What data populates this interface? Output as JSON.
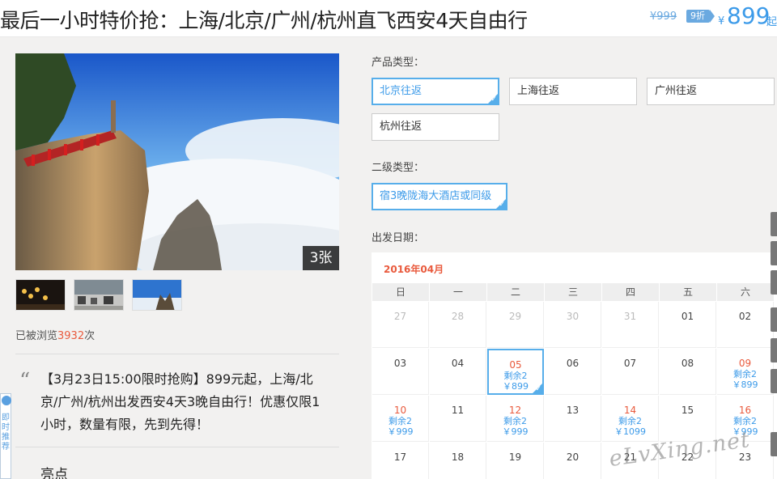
{
  "header": {
    "title": "最后一小时特价抢：上海/北京/广州/杭州直飞西安4天自由行",
    "original_price": "¥999",
    "discount": "9折",
    "yen": "¥",
    "price": "899",
    "price_suffix": "起"
  },
  "gallery": {
    "photo_count": "3张",
    "views_prefix": "已被浏览",
    "views_count": "3932",
    "views_suffix": "次"
  },
  "description": {
    "quote_mark": "“",
    "text": "【3月23日15:00限时抢购】899元起，上海/北京/广州/杭州出发西安4天3晚自由行！优惠仅限1小时，数量有限，先到先得！",
    "highlight_title": "亮点"
  },
  "side_tab": {
    "icon": "chat-icon",
    "text": "即时推荐"
  },
  "product_type": {
    "label": "产品类型：",
    "options": [
      {
        "label": "北京往返",
        "selected": true
      },
      {
        "label": "上海往返",
        "selected": false
      },
      {
        "label": "广州往返",
        "selected": false
      },
      {
        "label": "杭州往返",
        "selected": false
      }
    ]
  },
  "secondary_type": {
    "label": "二级类型：",
    "options": [
      {
        "label": "宿3晚陇海大酒店或同级",
        "selected": true
      }
    ]
  },
  "departure": {
    "label": "出发日期：",
    "month": "2016年04月",
    "weekdays": [
      "日",
      "一",
      "二",
      "三",
      "四",
      "五",
      "六"
    ],
    "weeks": [
      [
        {
          "day": "27",
          "status": "gray"
        },
        {
          "day": "28",
          "status": "gray"
        },
        {
          "day": "29",
          "status": "gray"
        },
        {
          "day": "30",
          "status": "gray"
        },
        {
          "day": "31",
          "status": "gray"
        },
        {
          "day": "01",
          "status": "normal"
        },
        {
          "day": "02",
          "status": "normal"
        }
      ],
      [
        {
          "day": "03",
          "status": "normal"
        },
        {
          "day": "04",
          "status": "normal"
        },
        {
          "day": "05",
          "status": "avail",
          "remain": "剩余2",
          "price": "￥899",
          "selected": true
        },
        {
          "day": "06",
          "status": "normal"
        },
        {
          "day": "07",
          "status": "normal"
        },
        {
          "day": "08",
          "status": "normal"
        },
        {
          "day": "09",
          "status": "avail",
          "remain": "剩余2",
          "price": "￥899"
        }
      ],
      [
        {
          "day": "10",
          "status": "avail",
          "remain": "剩余2",
          "price": "￥999"
        },
        {
          "day": "11",
          "status": "normal"
        },
        {
          "day": "12",
          "status": "avail",
          "remain": "剩余2",
          "price": "￥999"
        },
        {
          "day": "13",
          "status": "normal"
        },
        {
          "day": "14",
          "status": "avail",
          "remain": "剩余2",
          "price": "￥1099"
        },
        {
          "day": "15",
          "status": "normal"
        },
        {
          "day": "16",
          "status": "avail",
          "remain": "剩余2",
          "price": "￥999"
        }
      ],
      [
        {
          "day": "17",
          "status": "normal"
        },
        {
          "day": "18",
          "status": "normal"
        },
        {
          "day": "19",
          "status": "normal"
        },
        {
          "day": "20",
          "status": "normal"
        },
        {
          "day": "21",
          "status": "normal"
        },
        {
          "day": "22",
          "status": "normal"
        },
        {
          "day": "23",
          "status": "normal"
        }
      ]
    ]
  },
  "watermark": "eLvXing.net",
  "colors": {
    "accent": "#3d9be9",
    "highlight": "#e95a3d"
  }
}
